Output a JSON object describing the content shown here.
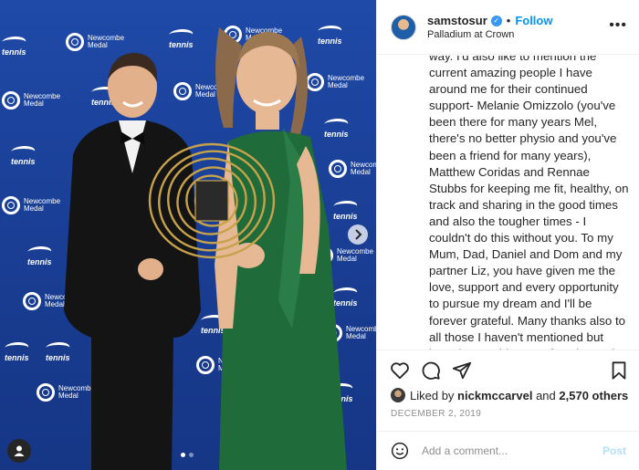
{
  "photo": {
    "backdrop_logos": [
      {
        "kind": "tennis",
        "text": "tennis"
      },
      {
        "kind": "newcombe",
        "line1": "Newcombe",
        "line2": "Medal"
      }
    ],
    "carousel_dots": 2,
    "active_dot": 0,
    "icons": {
      "next": "chevron-right-icon",
      "tag": "user-tag-icon"
    },
    "colors": {
      "backdrop": "#1f4aa8",
      "dress": "#1f6b3a"
    }
  },
  "header": {
    "username": "samstosur",
    "separator": "•",
    "follow_label": "Follow",
    "location": "Palladium at Crown",
    "more_label": "•••"
  },
  "caption": {
    "text": "way. I'd also like to mention the current amazing people I have around me for their continued support- Melanie Omizzolo (you've been there for many years Mel, there's no better physio and you've been a friend for many years), Matthew Coridas and Rennae Stubbs for keeping me fit, healthy, on track and sharing in the good times and also the tougher times - I couldn't do this without you. To my Mum, Dad, Daniel and Dom and my partner Liz, you have given me the love, support and every opportunity to pursue my dream and I'll be forever grateful. Many thanks also to all those I haven't mentioned but have been a big part of my longevity and success. I'm truly humbled to receive this award ☺"
  },
  "actions": {
    "icons": [
      "heart-icon",
      "comment-icon",
      "share-icon",
      "bookmark-icon"
    ]
  },
  "likes": {
    "prefix": "Liked by",
    "user": "nickmccarvel",
    "connector": "and",
    "others": "2,570 others"
  },
  "date": "DECEMBER 2, 2019",
  "comment": {
    "placeholder": "Add a comment...",
    "post_label": "Post"
  },
  "colors": {
    "accent": "#0095f6",
    "post_disabled": "#b2dffc",
    "text": "#262626",
    "muted": "#8e8e8e"
  }
}
